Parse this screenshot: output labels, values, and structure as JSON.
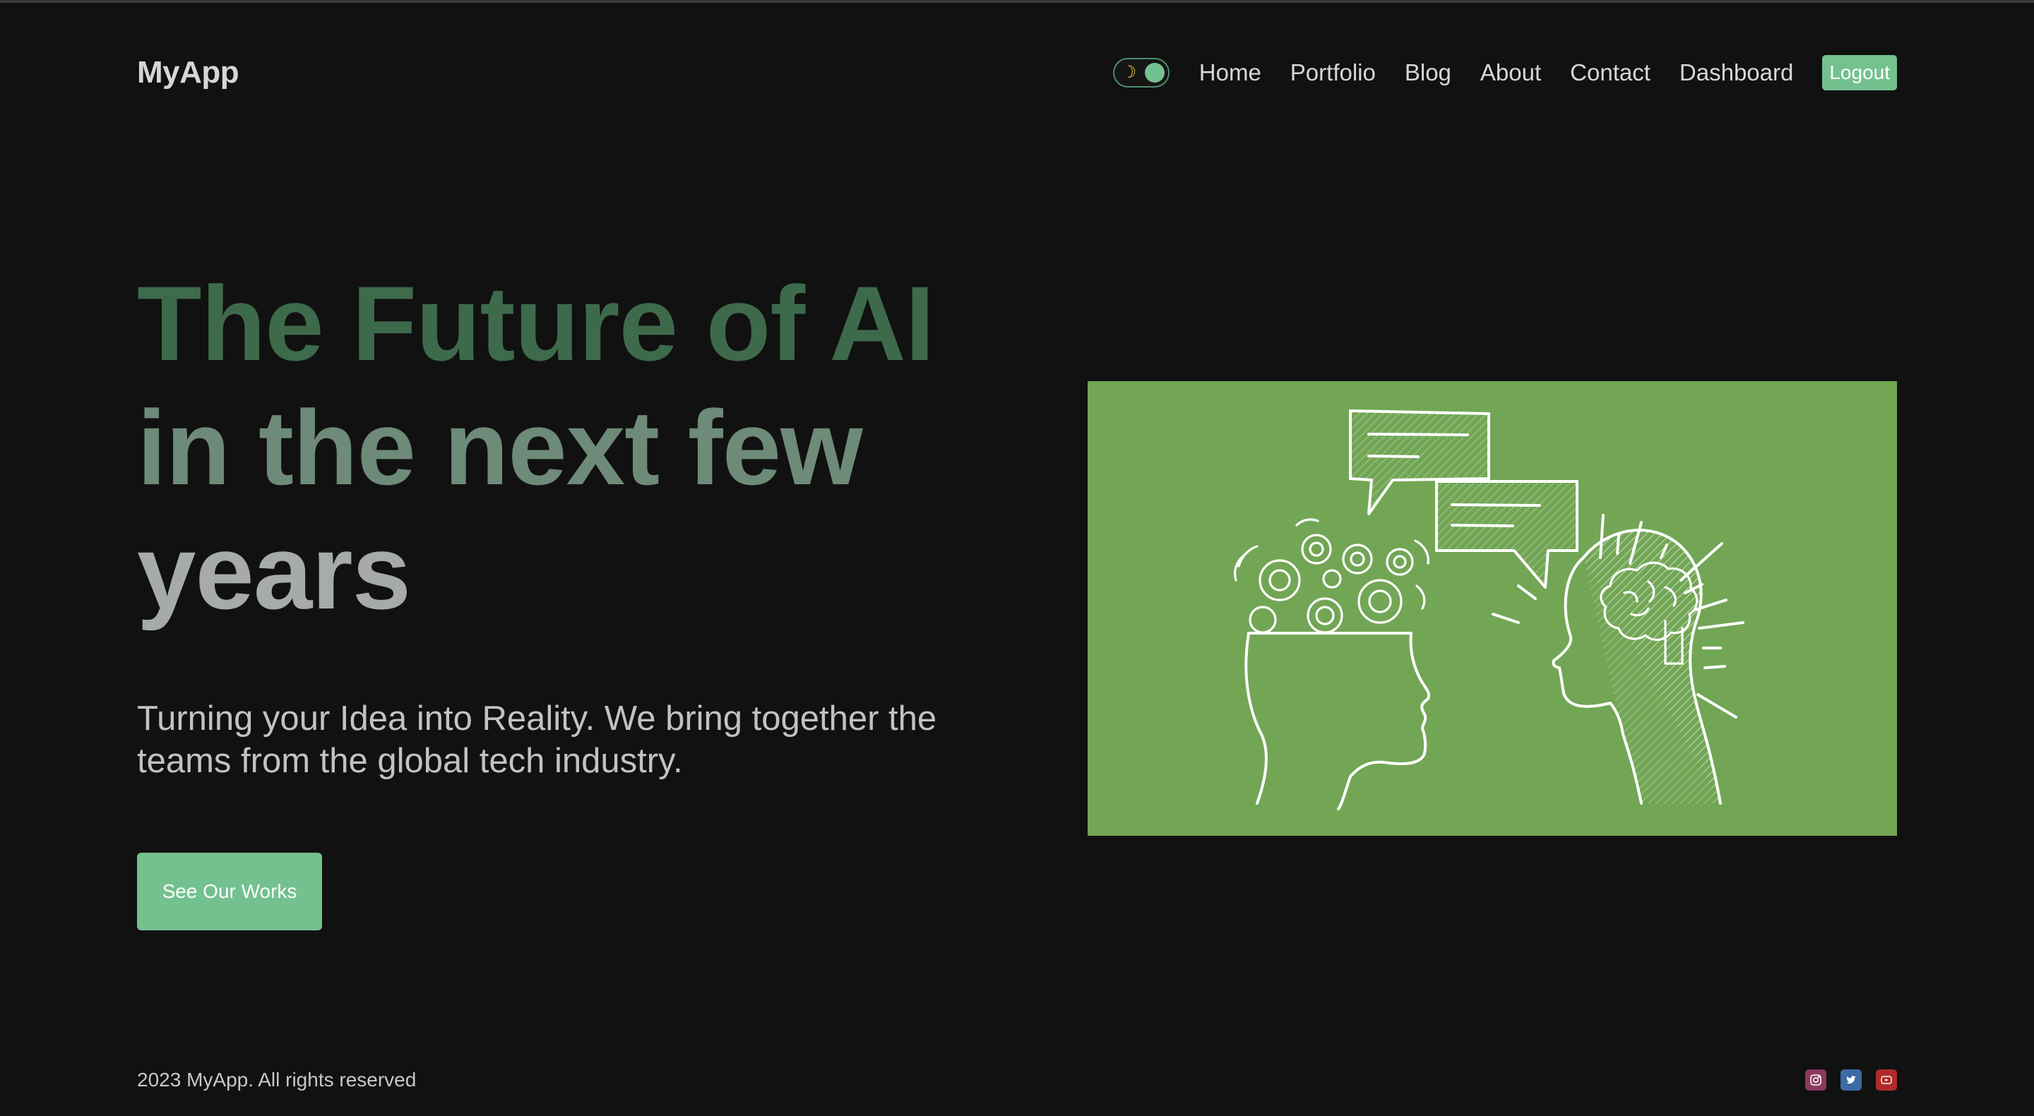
{
  "app": {
    "logo": "MyApp"
  },
  "nav": {
    "theme_toggle_icon": "moon-icon",
    "links": [
      "Home",
      "Portfolio",
      "Blog",
      "About",
      "Contact",
      "Dashboard"
    ],
    "logout_label": "Logout"
  },
  "hero": {
    "title_lines": [
      "The Future of AI",
      "in the next few",
      "years"
    ],
    "subtitle": "Turning your Idea into Reality. We bring together the teams from the global tech industry.",
    "cta_label": "See Our Works",
    "illustration_icon": "ai-heads-illustration"
  },
  "footer": {
    "copyright": "2023 MyApp. All rights reserved",
    "social_icons": [
      "instagram-icon",
      "twitter-icon",
      "youtube-icon"
    ]
  },
  "colors": {
    "background": "#111111",
    "accent": "#74c190",
    "illustration_bg": "#72a655",
    "title_line1": "#3e6a4c",
    "title_line2": "#6e8a79",
    "title_line3": "#a6aaa8"
  }
}
